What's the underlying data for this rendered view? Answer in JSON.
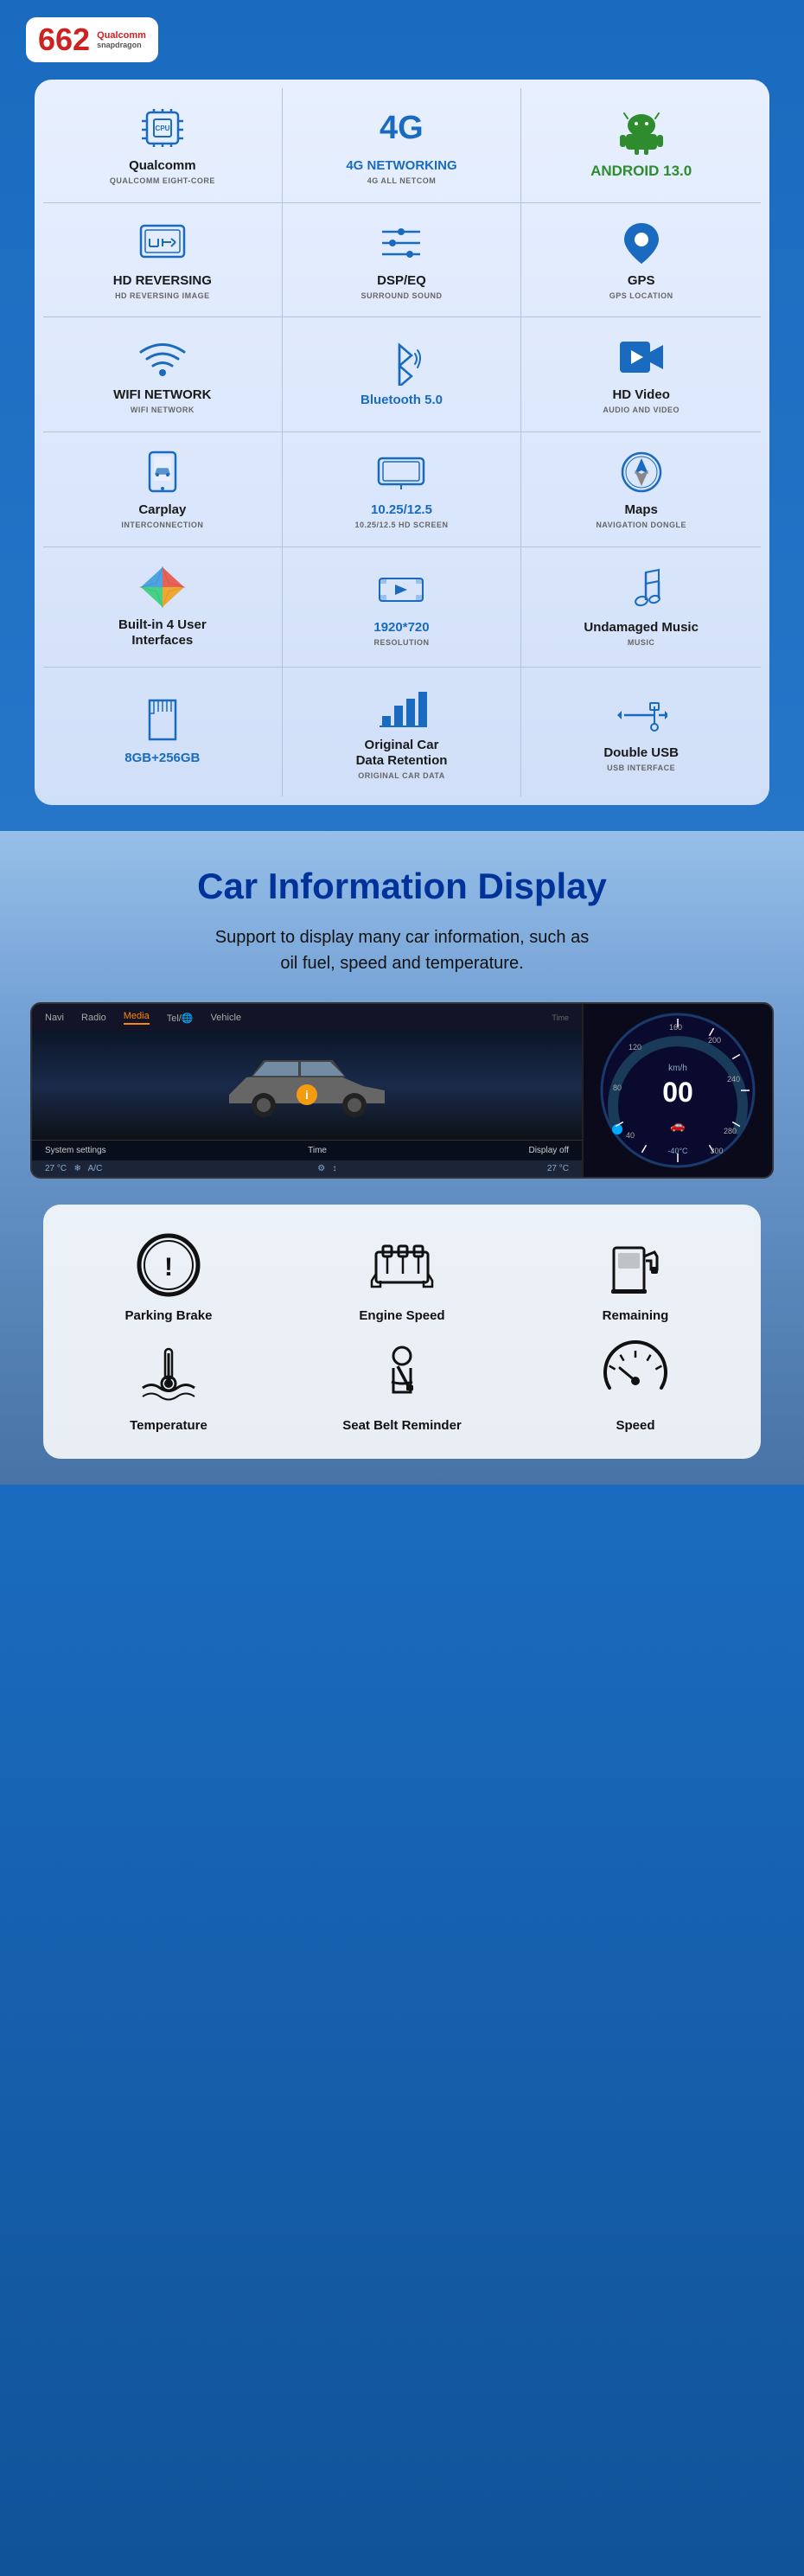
{
  "badge": {
    "number": "662",
    "brand": "Qualcomm",
    "model": "snapdragon"
  },
  "features": [
    {
      "id": "qualcomm",
      "title": "Qualcomm",
      "title_style": "normal",
      "subtitle": "QUALCOMM EIGHT-CORE",
      "icon": "cpu"
    },
    {
      "id": "4g-networking",
      "title": "4G NETWORKING",
      "title_style": "blue-big",
      "subtitle": "4G ALL NETCOM",
      "icon": "4g"
    },
    {
      "id": "android",
      "title": "ANDROID 13.0",
      "title_style": "android",
      "subtitle": "",
      "icon": "android"
    },
    {
      "id": "hd-reversing",
      "title": "HD REVERSING",
      "title_style": "normal",
      "subtitle": "HD REVERSING IMAGE",
      "icon": "hd-reverse"
    },
    {
      "id": "dsp-eq",
      "title": "DSP/EQ",
      "title_style": "normal",
      "subtitle": "SURROUND SOUND",
      "icon": "dsp"
    },
    {
      "id": "gps",
      "title": "GPS",
      "title_style": "normal",
      "subtitle": "GPS LOCATION",
      "icon": "gps"
    },
    {
      "id": "wifi",
      "title": "WIFI NETWORK",
      "title_style": "normal",
      "subtitle": "WIFI NETWORK",
      "icon": "wifi"
    },
    {
      "id": "bluetooth",
      "title": "Bluetooth 5.0",
      "title_style": "blue",
      "subtitle": "",
      "icon": "bluetooth"
    },
    {
      "id": "hd-video",
      "title": "HD Video",
      "title_style": "normal",
      "subtitle": "AUDIO AND VIDEO",
      "icon": "hd-video"
    },
    {
      "id": "carplay",
      "title": "Carplay",
      "title_style": "normal",
      "subtitle": "INTERCONNECTION",
      "icon": "carplay"
    },
    {
      "id": "screen-size",
      "title": "10.25/12.5",
      "title_style": "blue",
      "subtitle": "10.25/12.5 HD SCREEN",
      "icon": "screen"
    },
    {
      "id": "maps",
      "title": "Maps",
      "title_style": "normal",
      "subtitle": "NAVIGATION DONGLE",
      "icon": "maps"
    },
    {
      "id": "user-interfaces",
      "title": "Built-in 4 User\nInterfaces",
      "title_style": "normal",
      "subtitle": "",
      "icon": "ui4"
    },
    {
      "id": "resolution",
      "title": "1920*720",
      "title_style": "blue",
      "subtitle": "Resolution",
      "icon": "resolution"
    },
    {
      "id": "music",
      "title": "Undamaged Music",
      "title_style": "normal",
      "subtitle": "MUSIC",
      "icon": "music"
    },
    {
      "id": "storage",
      "title": "8GB+256GB",
      "title_style": "blue",
      "subtitle": "",
      "icon": "storage"
    },
    {
      "id": "car-data",
      "title": "Original Car\nData Retention",
      "title_style": "normal",
      "subtitle": "ORIGINAL CAR DATA",
      "icon": "car-data"
    },
    {
      "id": "usb",
      "title": "Double USB",
      "title_style": "normal",
      "subtitle": "USB INTERFACE",
      "icon": "usb"
    }
  ],
  "car_info": {
    "title": "Car Information Display",
    "description": "Support to display many car information, such as\noil fuel, speed and temperature.",
    "dashboard": {
      "nav_items": [
        "Navi",
        "Radio",
        "Media",
        "Tel/🌐",
        "Vehicle"
      ],
      "active_nav": "Media",
      "bottom_items": [
        "System settings",
        "Time",
        "Display off"
      ],
      "temp_left": "27 °C",
      "temp_right": "27 °C"
    },
    "icons": [
      {
        "id": "parking-brake",
        "label": "Parking Brake",
        "icon": "parking-brake"
      },
      {
        "id": "engine-speed",
        "label": "Engine Speed",
        "icon": "engine"
      },
      {
        "id": "remaining",
        "label": "Remaining",
        "icon": "fuel"
      },
      {
        "id": "temperature",
        "label": "Temperature",
        "icon": "temperature"
      },
      {
        "id": "seat-belt",
        "label": "Seat Belt Reminder",
        "icon": "seatbelt"
      },
      {
        "id": "speed",
        "label": "Speed",
        "icon": "speed"
      }
    ]
  },
  "colors": {
    "blue": "#1a6bbf",
    "dark_blue": "#003399",
    "android_green": "#2e8b2e"
  }
}
